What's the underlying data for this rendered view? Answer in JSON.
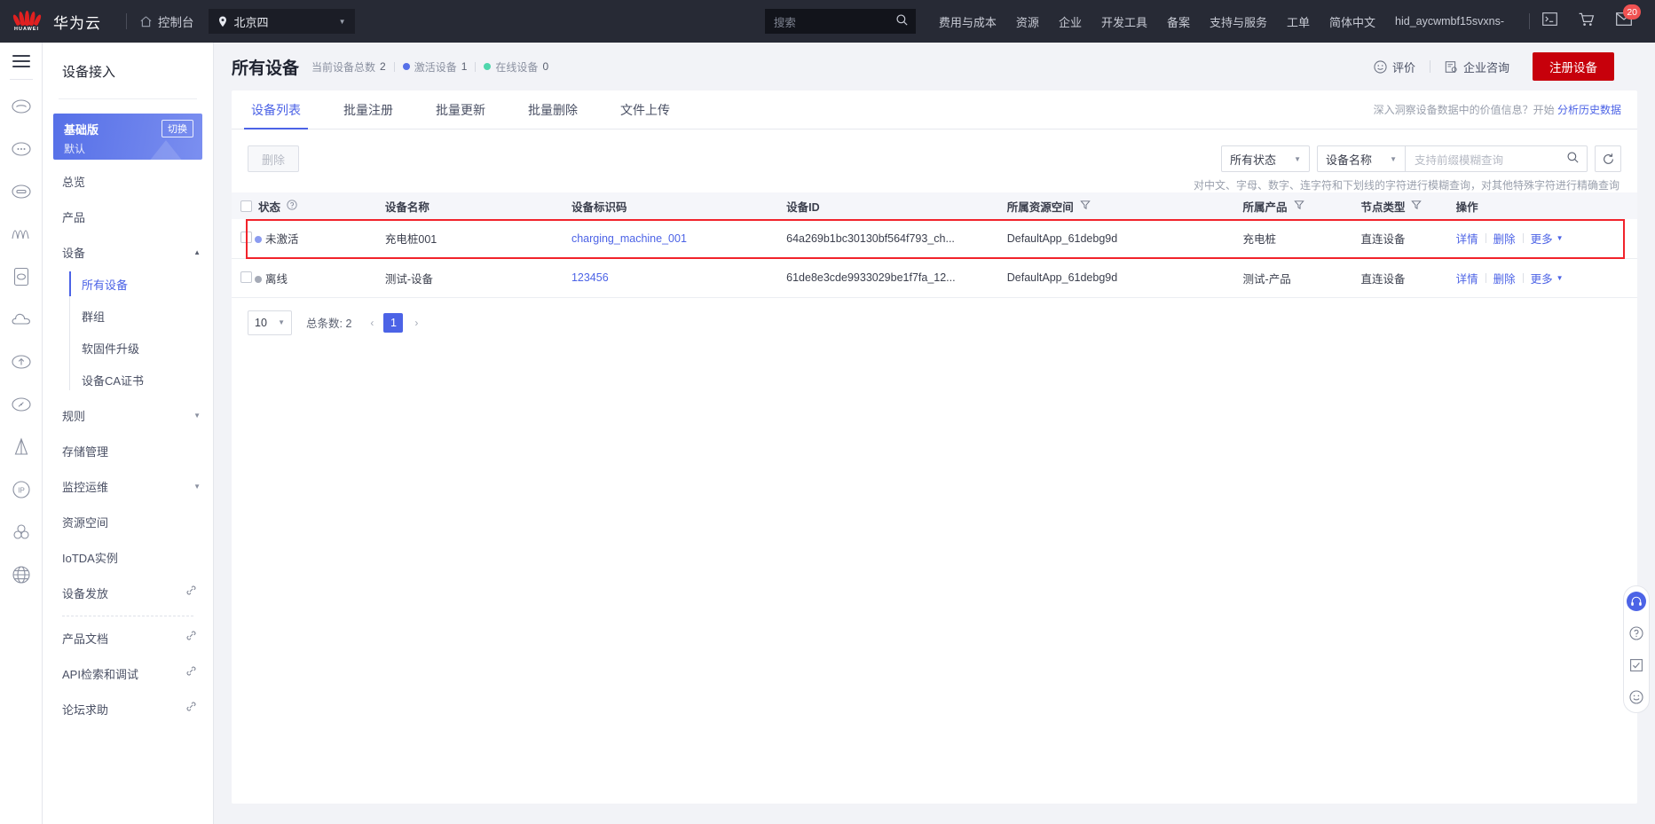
{
  "topbar": {
    "brand": "华为云",
    "console": "控制台",
    "region": "北京四",
    "search_placeholder": "搜索",
    "nav": [
      "费用与成本",
      "资源",
      "企业",
      "开发工具",
      "备案",
      "支持与服务",
      "工单",
      "简体中文"
    ],
    "user": "hid_aycwmbf15svxns-",
    "message_badge": "20",
    "icons": [
      "cloudshell-icon",
      "cart-icon",
      "message-icon"
    ]
  },
  "rail": {
    "menu_icon": "hamburger-icon",
    "icons": [
      "cloud-service-icon",
      "cloud-chat-icon",
      "cloud-storage-icon",
      "wave-icon",
      "device-icon",
      "cloud-outline-icon",
      "cloud-upload-icon",
      "cloud-speed-icon",
      "antenna-icon",
      "ip-icon",
      "cluster-icon",
      "globe-icon"
    ]
  },
  "sidebar": {
    "title": "设备接入",
    "edition": {
      "name": "基础版",
      "switch": "切换",
      "sub": "默认"
    },
    "items": [
      {
        "label": "总览",
        "type": "item"
      },
      {
        "label": "产品",
        "type": "item"
      },
      {
        "label": "设备",
        "type": "group",
        "expanded": true,
        "children": [
          {
            "label": "所有设备",
            "active": true
          },
          {
            "label": "群组",
            "active": false
          },
          {
            "label": "软固件升级",
            "active": false
          },
          {
            "label": "设备CA证书",
            "active": false
          }
        ]
      },
      {
        "label": "规则",
        "type": "group",
        "expanded": false
      },
      {
        "label": "存储管理",
        "type": "item"
      },
      {
        "label": "监控运维",
        "type": "group",
        "expanded": false
      },
      {
        "label": "资源空间",
        "type": "item"
      },
      {
        "label": "IoTDA实例",
        "type": "item"
      },
      {
        "label": "设备发放",
        "type": "link"
      }
    ],
    "footer_links": [
      {
        "label": "产品文档"
      },
      {
        "label": "API检索和调试"
      },
      {
        "label": "论坛求助"
      }
    ]
  },
  "page": {
    "title": "所有设备",
    "stats": [
      {
        "label": "当前设备总数",
        "value": "2",
        "dot": null
      },
      {
        "label": "激活设备",
        "value": "1",
        "dot": "#5670e8"
      },
      {
        "label": "在线设备",
        "value": "0",
        "dot": "#4fd6ac"
      }
    ],
    "rate_label": "评价",
    "consult_label": "企业咨询",
    "register_label": "注册设备"
  },
  "tabs": [
    {
      "label": "设备列表",
      "active": true
    },
    {
      "label": "批量注册",
      "active": false
    },
    {
      "label": "批量更新",
      "active": false
    },
    {
      "label": "批量删除",
      "active": false
    },
    {
      "label": "文件上传",
      "active": false
    }
  ],
  "tabs_hint": {
    "text": "深入洞察设备数据中的价值信息？开始",
    "link": "分析历史数据"
  },
  "toolbar": {
    "delete_label": "删除",
    "status_filter": "所有状态",
    "field_filter": "设备名称",
    "search_placeholder": "支持前缀模糊查询",
    "refresh_icon": "refresh-icon",
    "hint": "对中文、字母、数字、连字符和下划线的字符进行模糊查询，对其他特殊字符进行精确查询"
  },
  "table": {
    "columns": [
      {
        "label": "状态",
        "help": true
      },
      {
        "label": "设备名称"
      },
      {
        "label": "设备标识码"
      },
      {
        "label": "设备ID"
      },
      {
        "label": "所属资源空间",
        "filter": true
      },
      {
        "label": "所属产品",
        "filter": true
      },
      {
        "label": "节点类型",
        "filter": true
      },
      {
        "label": "操作"
      }
    ],
    "rows": [
      {
        "status": "未激活",
        "status_color": "#8b9bf0",
        "name": "充电桩001",
        "node_id": "charging_machine_001",
        "device_id": "64a269b1bc30130bf564f793_ch...",
        "space": "DefaultApp_61debg9d",
        "product": "充电桩",
        "node_type": "直连设备",
        "ops": [
          "详情",
          "删除",
          "更多"
        ],
        "highlighted": true
      },
      {
        "status": "离线",
        "status_color": "#a5aab6",
        "name": "测试-设备",
        "node_id": "123456",
        "device_id": "61de8e3cde9933029be1f7fa_12...",
        "space": "DefaultApp_61debg9d",
        "product": "测试-产品",
        "node_type": "直连设备",
        "ops": [
          "详情",
          "删除",
          "更多"
        ],
        "highlighted": false
      }
    ]
  },
  "pagination": {
    "page_size": "10",
    "total_label": "总条数:",
    "total": "2",
    "current_page": "1"
  },
  "floater": {
    "icons": [
      "headset-icon",
      "help-icon",
      "survey-icon",
      "smile-icon"
    ]
  },
  "colors": {
    "accent": "#4c63e6",
    "danger": "#c7000b",
    "highlight": "#f1232b",
    "topbar_bg": "#272a35"
  }
}
